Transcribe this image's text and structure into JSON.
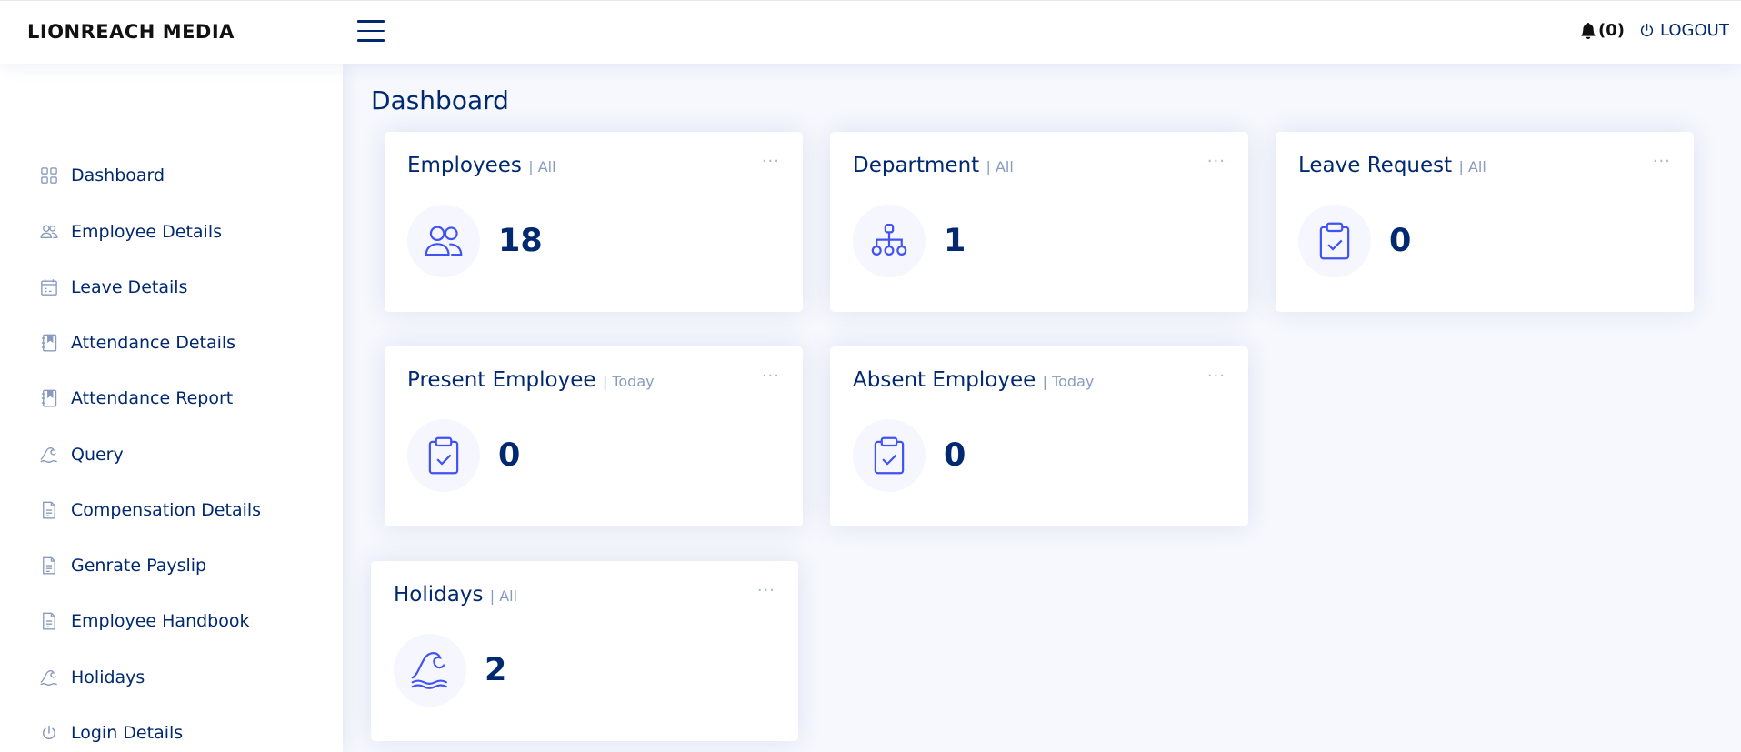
{
  "header": {
    "logo": "LIONREACH MEDIA",
    "notification_count": "(0)",
    "logout_label": "LOGOUT"
  },
  "sidebar": {
    "items": [
      {
        "label": "Dashboard",
        "icon": "grid-icon"
      },
      {
        "label": "Employee Details",
        "icon": "people-icon"
      },
      {
        "label": "Leave Details",
        "icon": "calendar-icon"
      },
      {
        "label": "Attendance Details",
        "icon": "journal-bookmark-icon"
      },
      {
        "label": "Attendance Report",
        "icon": "journal-bookmark-icon"
      },
      {
        "label": "Query",
        "icon": "wave-icon"
      },
      {
        "label": "Compensation Details",
        "icon": "file-text-icon"
      },
      {
        "label": "Genrate Payslip",
        "icon": "file-text-icon"
      },
      {
        "label": "Employee Handbook",
        "icon": "file-text-icon"
      },
      {
        "label": "Holidays",
        "icon": "wave-icon"
      },
      {
        "label": "Login Details",
        "icon": "power-icon"
      }
    ]
  },
  "main": {
    "title": "Dashboard",
    "cards": [
      {
        "title": "Employees",
        "filter": "| All",
        "value": "18",
        "icon": "people-icon"
      },
      {
        "title": "Department",
        "filter": "| All",
        "value": "1",
        "icon": "diagram-icon"
      },
      {
        "title": "Leave Request",
        "filter": "| All",
        "value": "0",
        "icon": "clipboard-check-icon"
      },
      {
        "title": "Present Employee",
        "filter": "| Today",
        "value": "0",
        "icon": "clipboard-check-icon"
      },
      {
        "title": "Absent Employee",
        "filter": "| Today",
        "value": "0",
        "icon": "clipboard-check-icon"
      },
      {
        "title": "Holidays",
        "filter": "| All",
        "value": "2",
        "icon": "wave-icon"
      }
    ],
    "menu_glyph": "···"
  },
  "colors": {
    "primary": "#012970",
    "accent": "#4154f1",
    "muted": "#899bbd",
    "background": "#f6f8fe"
  }
}
